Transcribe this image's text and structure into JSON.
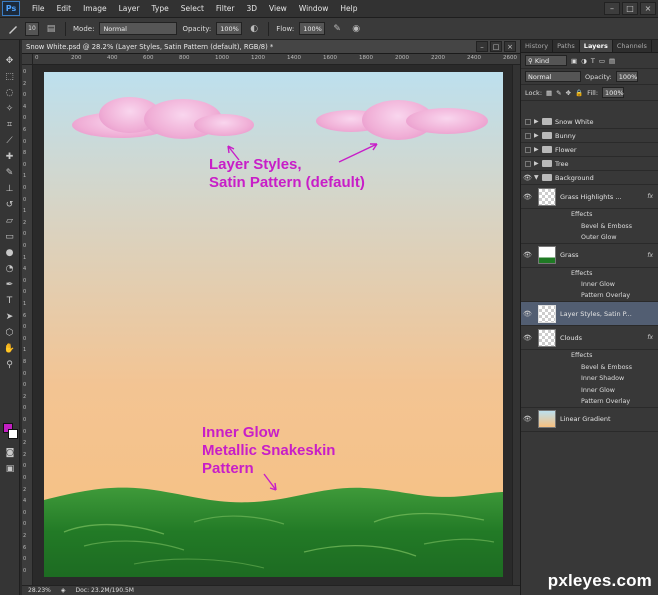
{
  "app": {
    "logo": "Ps"
  },
  "menu": [
    "File",
    "Edit",
    "Image",
    "Layer",
    "Type",
    "Select",
    "Filter",
    "3D",
    "View",
    "Window",
    "Help"
  ],
  "window_buttons": [
    "–",
    "□",
    "×"
  ],
  "options": {
    "brush_size": "10",
    "mode_label": "Mode:",
    "mode_value": "Normal",
    "opacity_label": "Opacity:",
    "opacity_value": "100%",
    "flow_label": "Flow:",
    "flow_value": "100%"
  },
  "document": {
    "tab_title": "Snow White.psd @ 28.2% (Layer Styles, Satin Pattern (default), RGB/8) *",
    "ruler_top": [
      "0",
      "200",
      "400",
      "600",
      "800",
      "1000",
      "1200",
      "1400",
      "1600",
      "1800",
      "2000",
      "2200",
      "2400",
      "2600"
    ],
    "ruler_left": [
      "0",
      "2",
      "0",
      "4",
      "0",
      "6",
      "0",
      "8",
      "0",
      "1",
      "0",
      "0",
      "1",
      "2",
      "0",
      "0",
      "1",
      "4",
      "0",
      "0",
      "1",
      "6",
      "0",
      "0",
      "1",
      "8",
      "0",
      "0",
      "2",
      "0",
      "0",
      "0",
      "2",
      "2",
      "0",
      "0",
      "2",
      "4",
      "0",
      "0",
      "2",
      "6",
      "0",
      "0"
    ],
    "zoom": "28.23%",
    "doc_size": "Doc: 23.2M/190.5M"
  },
  "annotations": {
    "clouds_line1": "Layer Styles,",
    "clouds_line2": "Satin Pattern (default)",
    "grass_line1": "Inner Glow",
    "grass_line2": "Metallic Snakeskin",
    "grass_line3": "Pattern"
  },
  "panel": {
    "tabs": [
      "History",
      "Paths",
      "Layers",
      "Channels"
    ],
    "kind_label": "Kind",
    "blend_mode": "Normal",
    "opacity_label": "Opacity:",
    "opacity_value": "100%",
    "lock_label": "Lock:",
    "fill_label": "Fill:",
    "fill_value": "100%",
    "folders": [
      "Snow White",
      "Bunny",
      "Flower",
      "Tree",
      "Background"
    ],
    "layers": {
      "grass_highlights": "Grass Highlights ...",
      "grass_highlights_effects": [
        "Effects",
        "Bevel & Emboss",
        "Outer Glow"
      ],
      "grass": "Grass",
      "grass_effects": [
        "Effects",
        "Inner Glow",
        "Pattern Overlay"
      ],
      "layer_styles": "Layer Styles, Satin P...",
      "clouds": "Clouds",
      "clouds_effects": [
        "Effects",
        "Bevel & Emboss",
        "Inner Shadow",
        "Inner Glow",
        "Pattern Overlay"
      ],
      "gradient": "Linear Gradient"
    },
    "fx_label": "fx"
  },
  "watermark": "pxleyes.com",
  "colors": {
    "foreground": "#c21fc2",
    "background": "#ffffff",
    "annotation": "#c81ec8"
  },
  "icons": [
    "move-icon",
    "marquee-icon",
    "lasso-icon",
    "quick-select-icon",
    "crop-icon",
    "eyedropper-icon",
    "healing-icon",
    "brush-icon",
    "stamp-icon",
    "history-brush-icon",
    "eraser-icon",
    "gradient-icon",
    "blur-icon",
    "dodge-icon",
    "pen-icon",
    "type-icon",
    "path-select-icon",
    "shape-icon",
    "hand-icon",
    "zoom-icon"
  ]
}
